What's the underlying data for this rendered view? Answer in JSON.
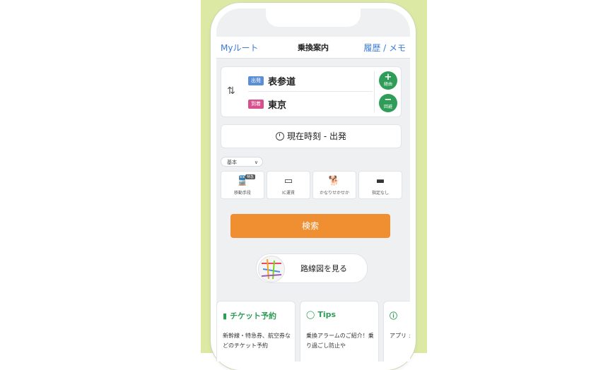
{
  "nav": {
    "left_label": "Myルート",
    "title": "乗換案内",
    "right_label": "履歴 / メモ"
  },
  "route": {
    "departure_tag": "出発",
    "departure_station": "表参道",
    "arrival_tag": "到着",
    "arrival_station": "東京",
    "add_via_label": "経由",
    "remove_via_label": "回避"
  },
  "time_button": {
    "label": "現在時刻 - 出発"
  },
  "options": {
    "preset": "基本",
    "items": [
      {
        "label": "移動手段",
        "badge": "特急"
      },
      {
        "label": "IC運賃"
      },
      {
        "label": "かなりせかせか"
      },
      {
        "label": "指定なし"
      }
    ]
  },
  "search_button": {
    "label": "検索"
  },
  "map_button": {
    "label": "路線図を見る"
  },
  "cards": [
    {
      "title": "チケット予約",
      "text": "新幹線・特急券、航空券などのチケット予約"
    },
    {
      "title": "Tips",
      "text": "乗換アラームのご紹介！乗り過ごし防止や"
    },
    {
      "title": "",
      "text": "アプリ ェック"
    }
  ],
  "colors": {
    "accent_blue": "#3b7ad9",
    "green": "#2f9d57",
    "orange": "#ef8f32",
    "departure_tag": "#5a8fd6",
    "arrival_tag": "#d84f8d",
    "background_panel": "#dbe9a5"
  }
}
